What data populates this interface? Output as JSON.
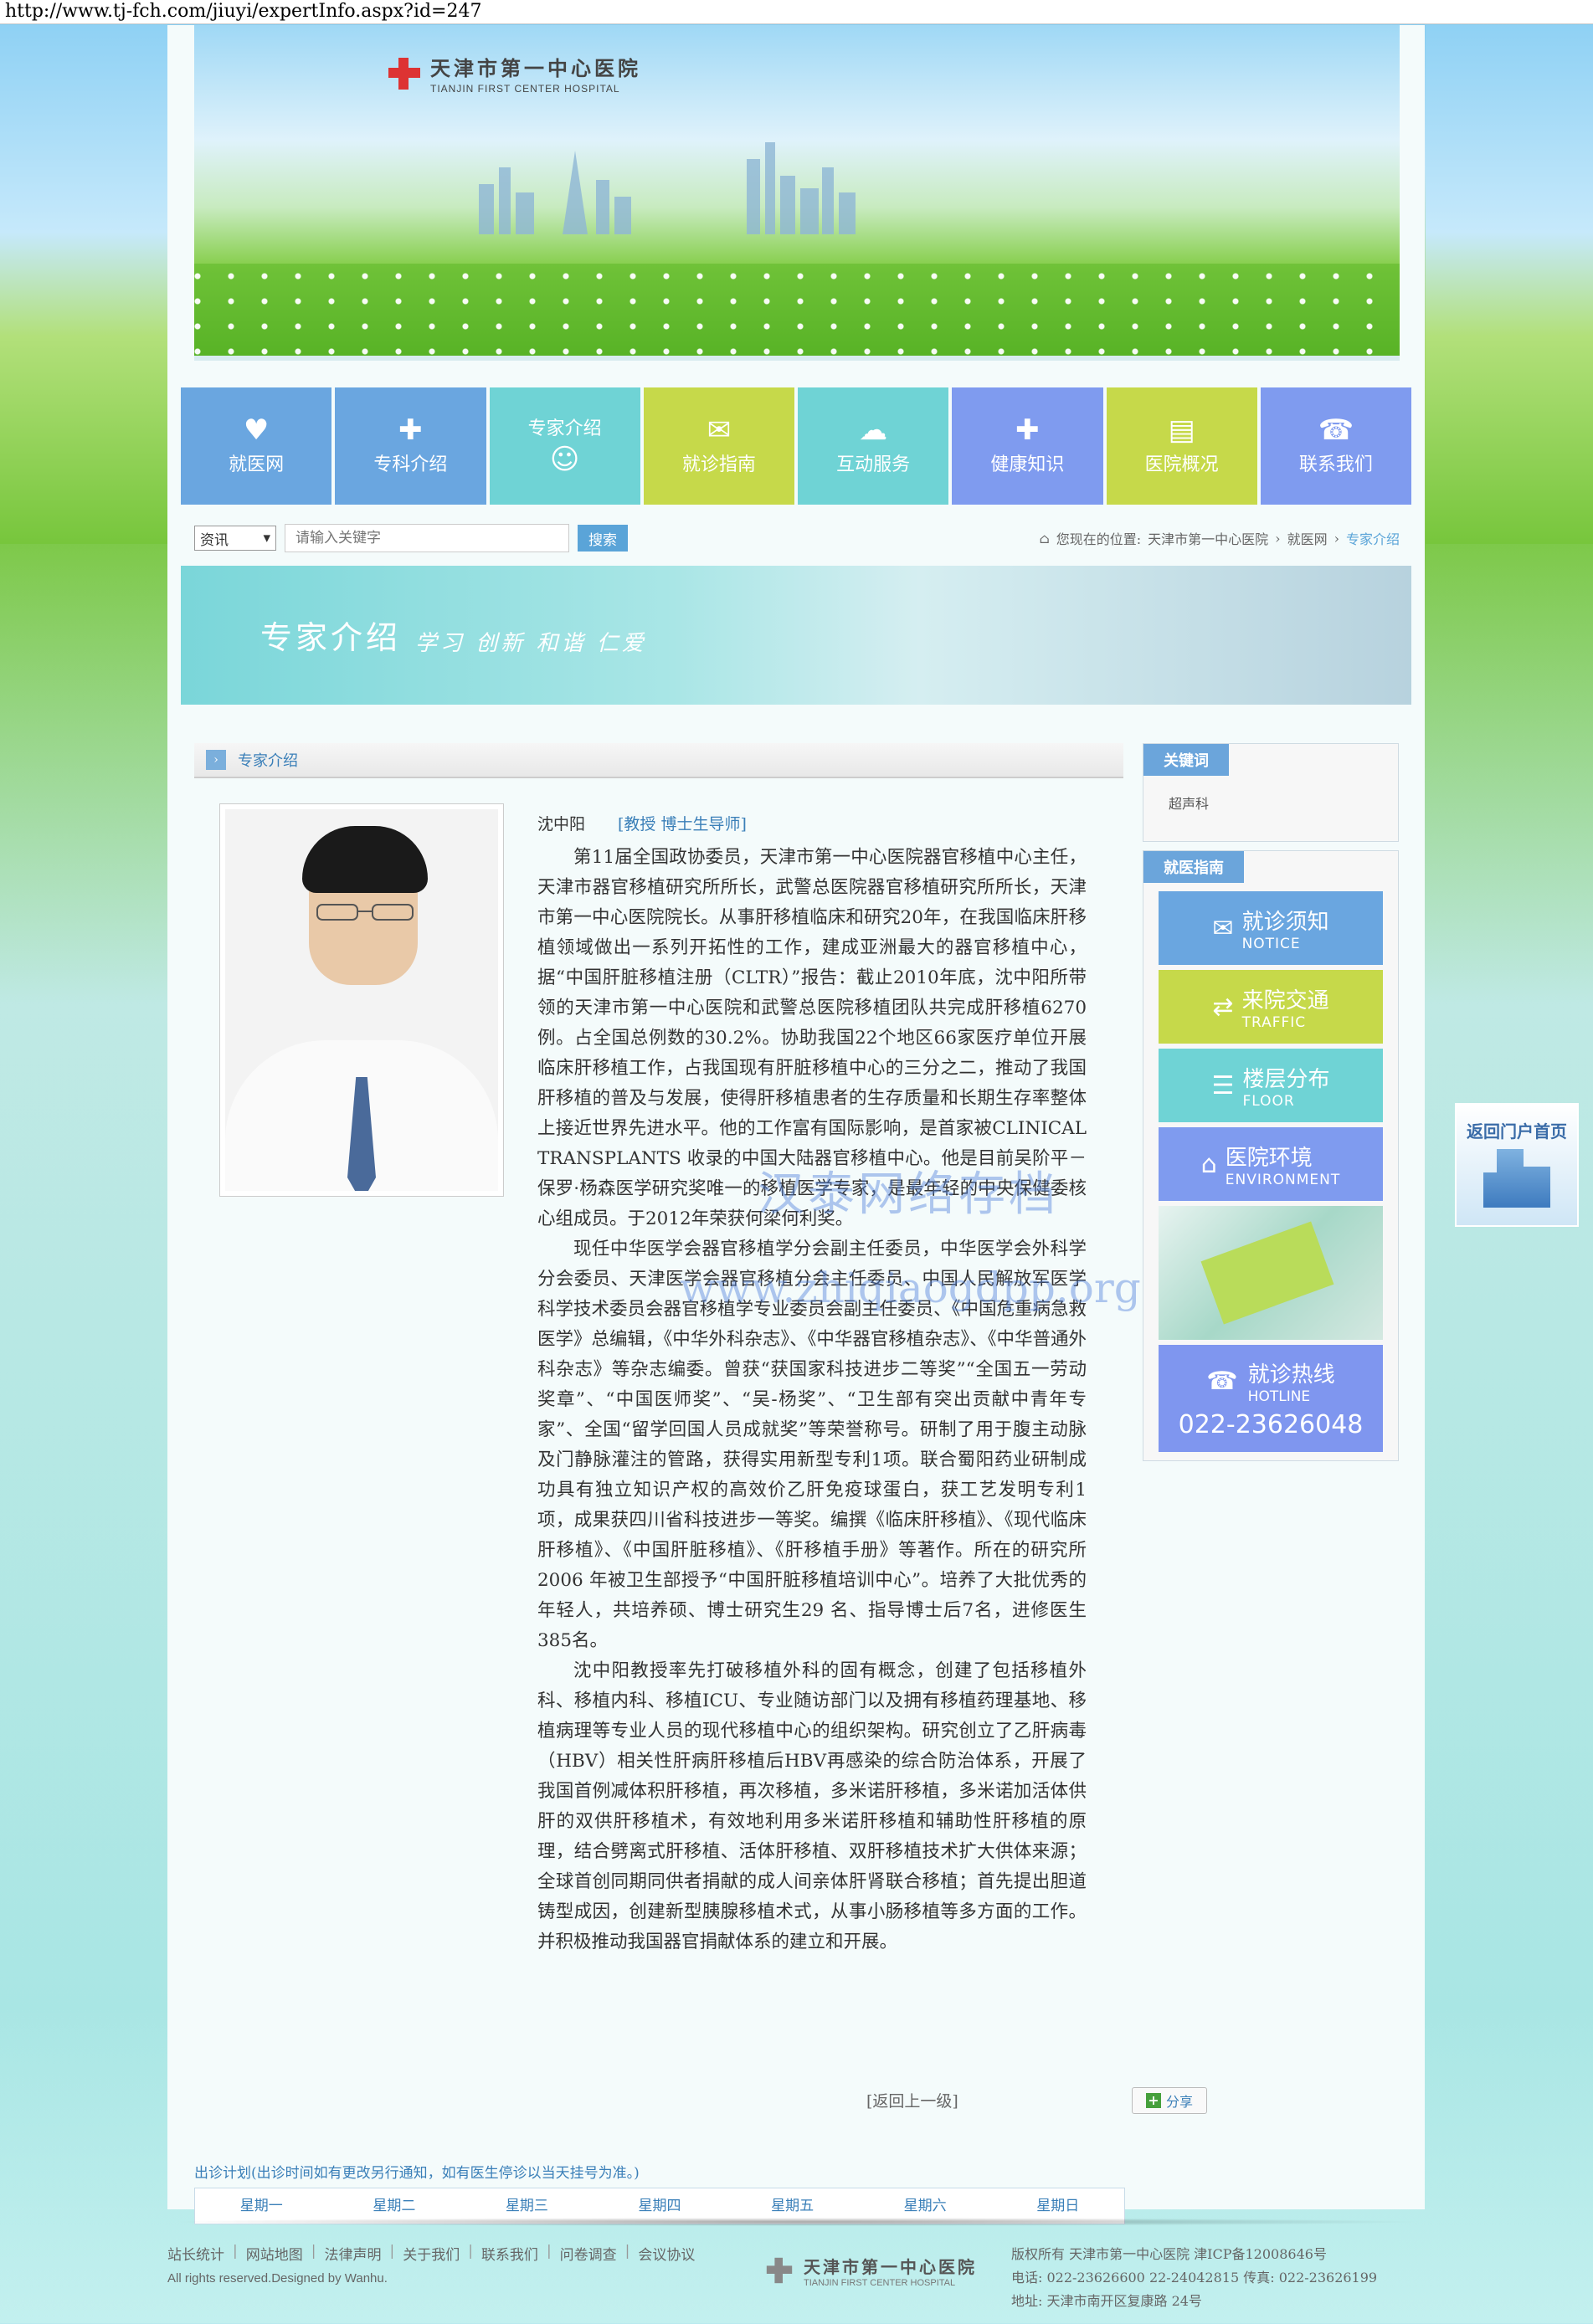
{
  "url": "http://www.tj-fch.com/jiuyi/expertInfo.aspx?id=247",
  "hospital": {
    "name_cn": "天津市第一中心医院",
    "name_en": "TIANJIN FIRST CENTER HOSPITAL"
  },
  "nav": [
    {
      "label": "就医网",
      "icon": "heart-plus-icon",
      "color": "#6aa6e0"
    },
    {
      "label": "专科介绍",
      "icon": "shield-plus-icon",
      "color": "#6aa6e0"
    },
    {
      "label": "专家介绍",
      "icon": "doctor-icon",
      "color": "#6fd3d5"
    },
    {
      "label": "就诊指南",
      "icon": "chat-icon",
      "color": "#c6d94a"
    },
    {
      "label": "互动服务",
      "icon": "cloud-icon",
      "color": "#6fd3d5"
    },
    {
      "label": "健康知识",
      "icon": "medkit-icon",
      "color": "#7f9bef"
    },
    {
      "label": "医院概况",
      "icon": "document-icon",
      "color": "#c6d94a"
    },
    {
      "label": "联系我们",
      "icon": "phone-icon",
      "color": "#7f9bef"
    }
  ],
  "search": {
    "select_value": "资讯",
    "placeholder": "请输入关键字",
    "button": "搜索"
  },
  "breadcrumb": {
    "prefix": "您现在的位置:",
    "items": [
      "天津市第一中心医院",
      "就医网",
      "专家介绍"
    ]
  },
  "subbanner": {
    "title": "专家介绍",
    "slogan": "学习 创新 和谐 仁爱"
  },
  "content_head": "专家介绍",
  "expert": {
    "name": "沈中阳",
    "title": "[教授 博士生导师]",
    "bio": [
      "第11届全国政协委员，天津市第一中心医院器官移植中心主任，天津市器官移植研究所所长，武警总医院器官移植研究所所长，天津市第一中心医院院长。从事肝移植临床和研究20年，在我国临床肝移植领域做出一系列开拓性的工作，建成亚洲最大的器官移植中心，据“中国肝脏移植注册（CLTR）”报告：截止2010年底，沈中阳所带领的天津市第一中心医院和武警总医院移植团队共完成肝移植6270例。占全国总例数的30.2%。协助我国22个地区66家医疗单位开展临床肝移植工作，占我国现有肝脏移植中心的三分之二，推动了我国肝移植的普及与发展，使得肝移植患者的生存质量和长期生存率整体上接近世界先进水平。他的工作富有国际影响，是首家被CLINICAL TRANSPLANTS 收录的中国大陆器官移植中心。他是目前吴阶平－保罗·杨森医学研究奖唯一的移植医学专家，是最年轻的中央保健委核心组成员。于2012年荣获何梁何利奖。",
      "现任中华医学会器官移植学分会副主任委员，中华医学会外科学分会委员、天津医学会器官移植分会主任委员、中国人民解放军医学科学技术委员会器官移植学专业委员会副主任委员、《中国危重病急救医学》总编辑，《中华外科杂志》、《中华器官移植杂志》、《中华普通外科杂志》等杂志编委。曾获“获国家科技进步二等奖”“全国五一劳动奖章”、“中国医师奖”、“吴-杨奖”、“卫生部有突出贡献中青年专家”、全国“留学回国人员成就奖”等荣誉称号。研制了用于腹主动脉及门静脉灌注的管路，获得实用新型专利1项。联合蜀阳药业研制成功具有独立知识产权的高效价乙肝免疫球蛋白，获工艺发明专利1 项，成果获四川省科技进步一等奖。编撰《临床肝移植》、《现代临床肝移植》、《中国肝脏移植》、《肝移植手册》等著作。所在的研究所2006 年被卫生部授予“中国肝脏移植培训中心”。培养了大批优秀的年轻人，共培养硕、博士研究生29 名、指导博士后7名，进修医生385名。",
      "沈中阳教授率先打破移植外科的固有概念，创建了包括移植外科、移植内科、移植ICU、专业随访部门以及拥有移植药理基地、移植病理等专业人员的现代移植中心的组织架构。研究创立了乙肝病毒（HBV）相关性肝病肝移植后HBV再感染的综合防治体系，开展了我国首例减体积肝移植，再次移植，多米诺肝移植，多米诺加活体供肝的双供肝移植术，有效地利用多米诺肝移植和辅助性肝移植的原理，结合劈离式肝移植、活体肝移植、双肝移植技术扩大供体来源；全球首创同期同供者捐献的成人间亲体肝肾联合移植；首先提出胆道铸型成因，创建新型胰腺移植术式，从事小肠移植等多方面的工作。并积极推动我国器官捐献体系的建立和开展。"
    ]
  },
  "watermark": {
    "line1": "汉泰网络存档",
    "line2": "www.zhiqiaogdpp.org"
  },
  "return_link": "[返回上一级]",
  "share_label": "分享",
  "schedule": {
    "note": "出诊计划(出诊时间如有更改另行通知，如有医生停诊以当天挂号为准。)",
    "days": [
      "星期一",
      "星期二",
      "星期三",
      "星期四",
      "星期五",
      "星期六",
      "星期日"
    ]
  },
  "sidebar": {
    "keywords_title": "关键词",
    "keywords": "超声科",
    "guide_title": "就医指南",
    "guide_items": [
      {
        "cn": "就诊须知",
        "en": "NOTICE",
        "icon": "chat-icon",
        "color": "#6aa6e0"
      },
      {
        "cn": "来院交通",
        "en": "TRAFFIC",
        "icon": "shuffle-icon",
        "color": "#c6d94a"
      },
      {
        "cn": "楼层分布",
        "en": "FLOOR",
        "icon": "layers-icon",
        "color": "#6fd3d5"
      },
      {
        "cn": "医院环境",
        "en": "ENVIRONMENT",
        "icon": "house-icon",
        "color": "#7f9bef"
      }
    ],
    "hotline": {
      "cn": "就诊热线",
      "en": "HOTLINE",
      "number": "022-23626048"
    }
  },
  "float_return": "返回门户首页",
  "footer": {
    "links": [
      "站长统计",
      "网站地图",
      "法律声明",
      "关于我们",
      "联系我们",
      "问卷调查",
      "会议协议"
    ],
    "rights": "All rights reserved.Designed by Wanhu.",
    "copyright": "版权所有 天津市第一中心医院 津ICP备12008646号",
    "phone": "电话: 022-23626600 22-24042815 传真: 022-23626199",
    "address": "地址: 天津市南开区复康路 24号"
  }
}
